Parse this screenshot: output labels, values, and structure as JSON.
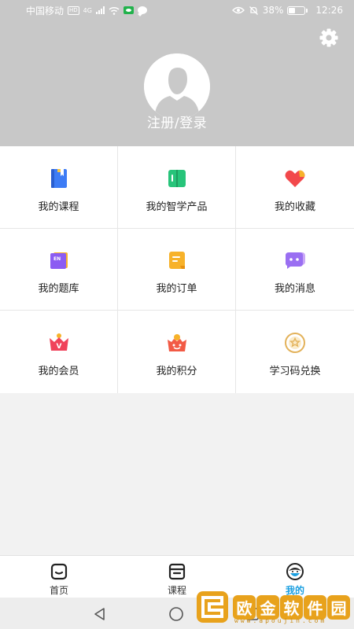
{
  "status_bar": {
    "carrier": "中国移动",
    "hd_badge": "HD",
    "network": "4G",
    "battery": "38%",
    "battery_level": 0.38,
    "time": "12:26"
  },
  "header": {
    "login_label": "注册/登录",
    "settings_icon": "gear-icon",
    "avatar_icon": "default-avatar-icon"
  },
  "menu": {
    "items": [
      {
        "label": "我的课程",
        "icon": "book-icon",
        "color": "#3d7cf5"
      },
      {
        "label": "我的智学产品",
        "icon": "open-book-icon",
        "color": "#27c47a"
      },
      {
        "label": "我的收藏",
        "icon": "heart-icon",
        "color": "#f2484b"
      },
      {
        "label": "我的题库",
        "icon": "question-bank-icon",
        "color": "#8c5cf2",
        "badge": "EN"
      },
      {
        "label": "我的订单",
        "icon": "order-icon",
        "color": "#f7b22a"
      },
      {
        "label": "我的消息",
        "icon": "message-icon",
        "color": "#9a6ff2"
      },
      {
        "label": "我的会员",
        "icon": "vip-crown-icon",
        "color": "#f0425a",
        "badge": "V"
      },
      {
        "label": "我的积分",
        "icon": "points-basket-icon",
        "color": "#f25a45"
      },
      {
        "label": "学习码兑换",
        "icon": "star-coin-icon",
        "color": "#e3b25a"
      }
    ]
  },
  "tab_bar": {
    "tabs": [
      {
        "label": "首页",
        "icon": "home-icon",
        "active": false
      },
      {
        "label": "课程",
        "icon": "course-icon",
        "active": false
      },
      {
        "label": "我的",
        "icon": "profile-face-icon",
        "active": true
      }
    ],
    "active_color": "#1a9fe0"
  },
  "watermark": {
    "chars": [
      "欧",
      "金",
      "软",
      "件",
      "园"
    ],
    "url": "www.apoujin.com"
  }
}
